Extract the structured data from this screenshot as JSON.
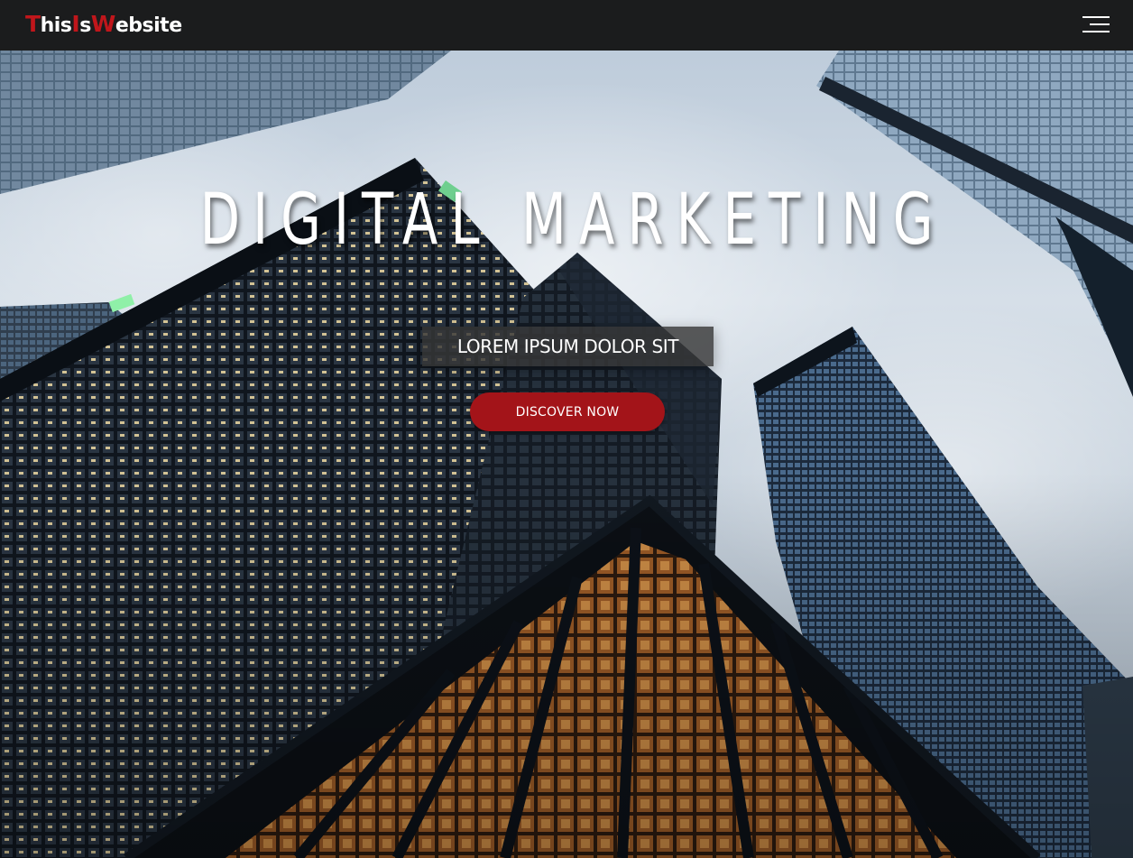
{
  "brand": {
    "logo_parts": [
      {
        "text": "T",
        "style": "cap"
      },
      {
        "text": "his",
        "style": "low"
      },
      {
        "text": "I",
        "style": "cap"
      },
      {
        "text": "s",
        "style": "low"
      },
      {
        "text": "W",
        "style": "cap"
      },
      {
        "text": "ebsite",
        "style": "low"
      }
    ],
    "accent_color": "#c0161b"
  },
  "nav": {
    "menu_icon": "hamburger-menu-icon"
  },
  "hero": {
    "title": "DIGITAL MARKETING",
    "subtitle": "LOREM IPSUM DOLOR SIT",
    "cta_label": "DISCOVER NOW",
    "cta_color": "#a31419",
    "background": "skyscrapers-looking-up-photo"
  }
}
